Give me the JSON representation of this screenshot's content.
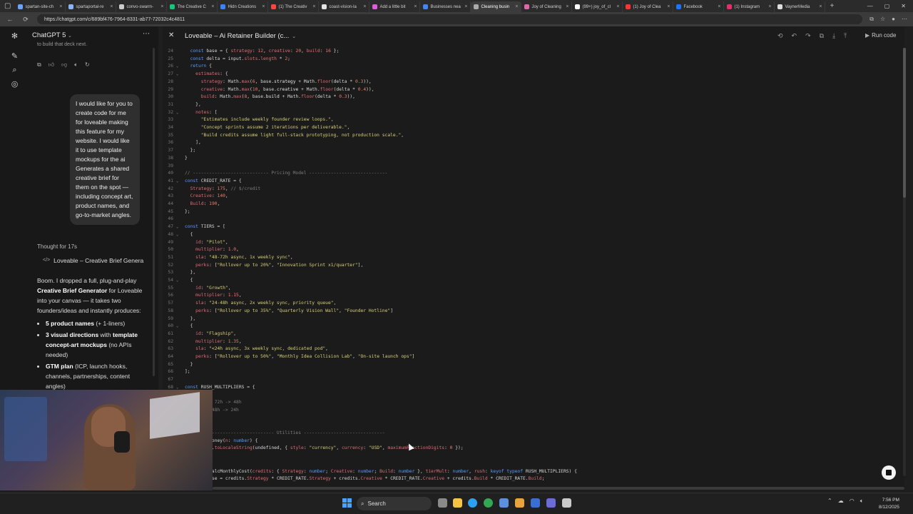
{
  "browser": {
    "tabs": [
      {
        "label": "spartan-site-ch",
        "color": "#6aa3ff"
      },
      {
        "label": "spartaportal-re",
        "color": "#8ab4f8"
      },
      {
        "label": "convo-swarm-",
        "color": "#cccccc"
      },
      {
        "label": "The Creative C",
        "color": "#19c37d"
      },
      {
        "label": "Hidn Creations",
        "color": "#3b82f6"
      },
      {
        "label": "(1) The Creativ",
        "color": "#ff4444"
      },
      {
        "label": "coast-vision-la",
        "color": "#e3e3e3"
      },
      {
        "label": "Add a little bit",
        "color": "#e05cd8"
      },
      {
        "label": "Businesses nea",
        "color": "#4285f4"
      },
      {
        "label": "Cleaning busin",
        "color": "#aaaaaa"
      },
      {
        "label": "Joy of Cleaning",
        "color": "#e066a8"
      },
      {
        "label": "(99+) joy_of_cl",
        "color": "#ffffff"
      },
      {
        "label": "(1) Joy of Clea",
        "color": "#ff3333"
      },
      {
        "label": "Facebook",
        "color": "#1877f2"
      },
      {
        "label": "(1) Instagram",
        "color": "#e1306c"
      },
      {
        "label": "VaynerMedia",
        "color": "#dddddd"
      }
    ],
    "active_tab_index": 9,
    "url": "https://chatgpt.com/c/689bf476-7964-8331-ab77-72032c4c4811"
  },
  "chat": {
    "model_label": "ChatGPT 5",
    "scroll_top_text": "to build that deck next.",
    "user_message": "I would like for you to create code for me for loveable making this feature for my website. I would like it to use template mockups for the ai Generates a shared creative brief for them on the spot — including concept art, product names, and go-to-market angles.",
    "thought_label": "Thought for 17s",
    "artifact_label": "Loveable – Creative Brief Genera",
    "reply_intro_1": "Boom. I dropped a full, plug-and-play ",
    "reply_intro_bold": "Creative Brief Generator",
    "reply_intro_2": " for Loveable into your canvas — it takes two founders/ideas and instantly produces:",
    "bullets": [
      {
        "bold": "5 product names",
        "rest": " (+ 1-liners)"
      },
      {
        "bold": "3 visual directions",
        "rest": " with ",
        "bold2": "template concept-art mockups",
        "rest2": " (no APIs needed)"
      },
      {
        "bold": "GTM plan",
        "rest": " (ICP, launch hooks, channels, partnerships, content angles)"
      }
    ]
  },
  "canvas": {
    "title": "Loveable – Ai Retainer Builder (c...",
    "run_label": "Run code"
  },
  "taskbar": {
    "search_placeholder": "Search",
    "time": "7:56 PM",
    "date": "8/12/2025"
  },
  "code_lines": [
    {
      "n": "24",
      "fold": "",
      "html": "  <span class='k'>const</span> base = { <span class='p'>strategy</span>: <span class='n'>12</span>, <span class='p'>creative</span>: <span class='n'>20</span>, <span class='p'>build</span>: <span class='n'>16</span> };"
    },
    {
      "n": "25",
      "fold": "",
      "html": "  <span class='k'>const</span> delta = input.<span class='p'>slots</span>.<span class='p'>length</span> * <span class='n'>2</span>;"
    },
    {
      "n": "26",
      "fold": "v",
      "html": "  <span class='k'>return</span> {"
    },
    {
      "n": "27",
      "fold": "v",
      "html": "    <span class='p'>estimates</span>: {"
    },
    {
      "n": "28",
      "fold": "",
      "html": "      <span class='p'>strategy</span>: Math.<span class='p'>max</span>(<span class='n'>6</span>, base.<span class='f'>strategy</span> + Math.<span class='p'>floor</span>(delta * <span class='n'>0.3</span>)),"
    },
    {
      "n": "29",
      "fold": "",
      "html": "      <span class='p'>creative</span>: Math.<span class='p'>max</span>(<span class='n'>10</span>, base.<span class='f'>creative</span> + Math.<span class='p'>floor</span>(delta * <span class='n'>0.4</span>)),"
    },
    {
      "n": "30",
      "fold": "",
      "html": "      <span class='p'>build</span>: Math.<span class='p'>max</span>(<span class='n'>8</span>, base.<span class='f'>build</span> + Math.<span class='p'>floor</span>(delta * <span class='n'>0.3</span>)),"
    },
    {
      "n": "31",
      "fold": "",
      "html": "    },"
    },
    {
      "n": "32",
      "fold": "v",
      "html": "    <span class='p'>notes</span>: ["
    },
    {
      "n": "33",
      "fold": "",
      "html": "      <span class='s'>\"Estimates include weekly founder review loops.\"</span>,"
    },
    {
      "n": "34",
      "fold": "",
      "html": "      <span class='s'>\"Concept sprints assume 2 iterations per deliverable.\"</span>,"
    },
    {
      "n": "35",
      "fold": "",
      "html": "      <span class='s'>\"Build credits assume light full-stack prototyping, not production scale.\"</span>,"
    },
    {
      "n": "36",
      "fold": "",
      "html": "    ],"
    },
    {
      "n": "37",
      "fold": "",
      "html": "  };"
    },
    {
      "n": "38",
      "fold": "",
      "html": "}"
    },
    {
      "n": "39",
      "fold": "",
      "html": ""
    },
    {
      "n": "40",
      "fold": "",
      "html": "<span class='c'>// ---------------------------- Pricing Model -----------------------------</span>"
    },
    {
      "n": "41",
      "fold": "v",
      "html": "<span class='k'>const</span> CREDIT_RATE = {"
    },
    {
      "n": "42",
      "fold": "",
      "html": "  <span class='p'>Strategy</span>: <span class='n'>175</span>, <span class='c'>// $/credit</span>"
    },
    {
      "n": "43",
      "fold": "",
      "html": "  <span class='p'>Creative</span>: <span class='n'>140</span>,"
    },
    {
      "n": "44",
      "fold": "",
      "html": "  <span class='p'>Build</span>: <span class='n'>190</span>,"
    },
    {
      "n": "45",
      "fold": "",
      "html": "};"
    },
    {
      "n": "46",
      "fold": "",
      "html": ""
    },
    {
      "n": "47",
      "fold": "v",
      "html": "<span class='k'>const</span> TIERS = ["
    },
    {
      "n": "48",
      "fold": "v",
      "html": "  {"
    },
    {
      "n": "49",
      "fold": "",
      "html": "    <span class='p'>id</span>: <span class='s'>\"Pilot\"</span>,"
    },
    {
      "n": "50",
      "fold": "",
      "html": "    <span class='p'>multiplier</span>: <span class='n'>1.0</span>,"
    },
    {
      "n": "51",
      "fold": "",
      "html": "    <span class='p'>sla</span>: <span class='s'>\"48-72h async, 1x weekly sync\"</span>,"
    },
    {
      "n": "52",
      "fold": "",
      "html": "    <span class='p'>perks</span>: [<span class='s'>\"Rollover up to 20%\"</span>, <span class='s'>\"Innovation Sprint x1/quarter\"</span>],"
    },
    {
      "n": "53",
      "fold": "",
      "html": "  },"
    },
    {
      "n": "54",
      "fold": "v",
      "html": "  {"
    },
    {
      "n": "55",
      "fold": "",
      "html": "    <span class='p'>id</span>: <span class='s'>\"Growth\"</span>,"
    },
    {
      "n": "56",
      "fold": "",
      "html": "    <span class='p'>multiplier</span>: <span class='n'>1.15</span>,"
    },
    {
      "n": "57",
      "fold": "",
      "html": "    <span class='p'>sla</span>: <span class='s'>\"24-48h async, 2x weekly sync, priority queue\"</span>,"
    },
    {
      "n": "58",
      "fold": "",
      "html": "    <span class='p'>perks</span>: [<span class='s'>\"Rollover up to 35%\"</span>, <span class='s'>\"Quarterly Vision Wall\"</span>, <span class='s'>\"Founder Hotline\"</span>]"
    },
    {
      "n": "59",
      "fold": "",
      "html": "  },"
    },
    {
      "n": "60",
      "fold": "v",
      "html": "  {"
    },
    {
      "n": "61",
      "fold": "",
      "html": "    <span class='p'>id</span>: <span class='s'>\"Flagship\"</span>,"
    },
    {
      "n": "62",
      "fold": "",
      "html": "    <span class='p'>multiplier</span>: <span class='n'>1.35</span>,"
    },
    {
      "n": "63",
      "fold": "",
      "html": "    <span class='p'>sla</span>: <span class='s'>\"<24h async, 3x weekly sync, dedicated pod\"</span>,"
    },
    {
      "n": "64",
      "fold": "",
      "html": "    <span class='p'>perks</span>: [<span class='s'>\"Rollover up to 50%\"</span>, <span class='s'>\"Monthly Idea Collision Lab\"</span>, <span class='s'>\"On-site launch ops\"</span>]"
    },
    {
      "n": "65",
      "fold": "",
      "html": "  }"
    },
    {
      "n": "66",
      "fold": "",
      "html": "];"
    },
    {
      "n": "67",
      "fold": "",
      "html": ""
    },
    {
      "n": "68",
      "fold": "v",
      "html": "<span class='k'>const</span> RUSH_MULTIPLIERS = {"
    },
    {
      "n": "69",
      "fold": "",
      "html": "  ,"
    },
    {
      "n": "70",
      "fold": "",
      "html": "  <span class='n'>1.25</span>, <span class='c'>// 72h -> 48h</span>"
    },
    {
      "n": "71",
      "fold": "",
      "html": "  <span class='n'>1.5</span>, <span class='c'>// 48h -> 24h</span>"
    },
    {
      "n": "72",
      "fold": "",
      "html": ""
    },
    {
      "n": "73",
      "fold": "",
      "html": ""
    },
    {
      "n": "74",
      "fold": "",
      "html": "<span class='c'>// ------------------------------ Utilities ------------------------------</span>"
    },
    {
      "n": "75",
      "fold": "",
      "html": "<span class='k'>function</span> money(<span class='p'>n</span>: <span class='k'>number</span>) {"
    },
    {
      "n": "76",
      "fold": "",
      "html": "  <span class='k'>return</span> n.<span class='p'>toLocaleString</span>(undefined, { <span class='p'>style</span>: <span class='s'>\"currency\"</span>, <span class='p'>currency</span>: <span class='s'>\"USD\"</span>, <span class='p'>maximumFractionDigits</span>: <span class='n'>0</span> });"
    },
    {
      "n": "77",
      "fold": "",
      "html": "}"
    },
    {
      "n": "78",
      "fold": "",
      "html": ""
    },
    {
      "n": "79",
      "fold": "",
      "html": "<span class='k'>function</span> calcMonthlyCost(<span class='p'>credits</span>: { <span class='p'>Strategy</span>: <span class='k'>number</span>; <span class='p'>Creative</span>: <span class='k'>number</span>; <span class='p'>Build</span>: <span class='k'>number</span> }, <span class='p'>tierMult</span>: <span class='k'>number</span>, <span class='p'>rush</span>: <span class='k'>keyof typeof</span> RUSH_MULTIPLIERS) {"
    },
    {
      "n": "80",
      "fold": "",
      "html": "  <span class='k'>const</span> base = credits.<span class='p'>Strategy</span> * CREDIT_RATE.<span class='p'>Strategy</span> + credits.<span class='p'>Creative</span> * CREDIT_RATE.<span class='p'>Creative</span> + credits.<span class='p'>Build</span> * CREDIT_RATE.<span class='p'>Build</span>;"
    }
  ]
}
